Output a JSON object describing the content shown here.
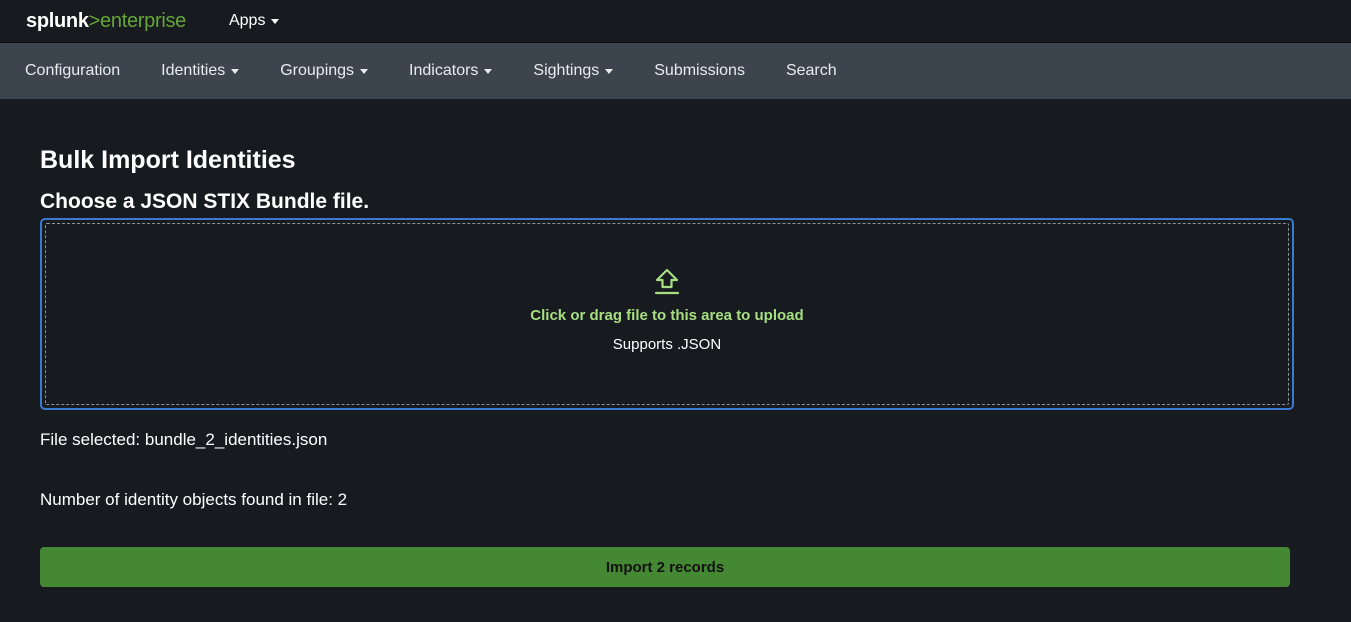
{
  "brand": {
    "name": "splunk",
    "separator": ">",
    "product": "enterprise"
  },
  "topbar": {
    "apps_label": "Apps"
  },
  "nav": {
    "items": [
      {
        "label": "Configuration",
        "has_dropdown": false
      },
      {
        "label": "Identities",
        "has_dropdown": true
      },
      {
        "label": "Groupings",
        "has_dropdown": true
      },
      {
        "label": "Indicators",
        "has_dropdown": true
      },
      {
        "label": "Sightings",
        "has_dropdown": true
      },
      {
        "label": "Submissions",
        "has_dropdown": false
      },
      {
        "label": "Search",
        "has_dropdown": false
      }
    ]
  },
  "page": {
    "title": "Bulk Import Identities",
    "subtitle": "Choose a JSON STIX Bundle file."
  },
  "dropzone": {
    "icon": "upload-icon",
    "hint": "Click or drag file to this area to upload",
    "supports": "Supports .JSON"
  },
  "status": {
    "file_selected": "File selected: bundle_2_identities.json",
    "object_count": "Number of identity objects found in file: 2"
  },
  "actions": {
    "import_label": "Import 2 records"
  },
  "colors": {
    "background": "#171b20",
    "navbar": "#3c444d",
    "brand_accent": "#65a637",
    "dropzone_border": "#3b7ad1",
    "hint_text": "#a8de82",
    "import_button": "#448833"
  }
}
